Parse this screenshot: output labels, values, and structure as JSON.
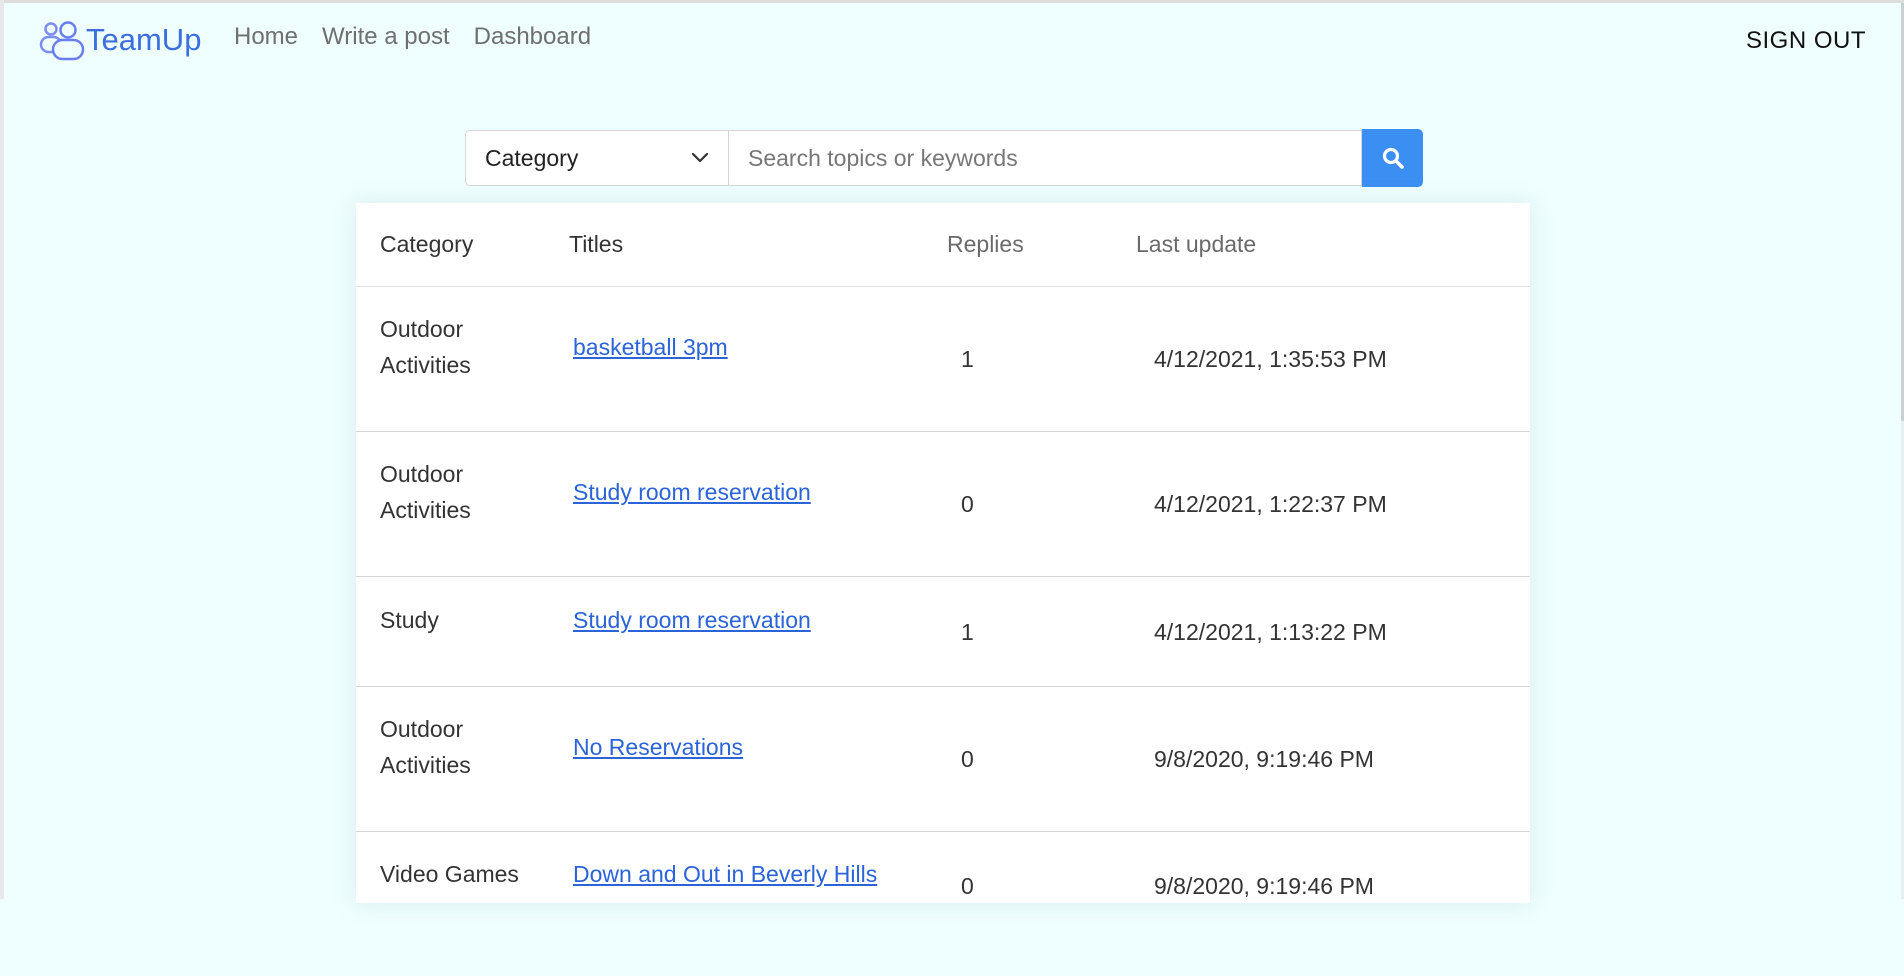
{
  "navbar": {
    "brand": "TeamUp",
    "links": [
      "Home",
      "Write a post",
      "Dashboard"
    ],
    "sign_out": "SIGN OUT"
  },
  "search": {
    "category_label": "Category",
    "placeholder": "Search topics or keywords"
  },
  "table": {
    "headers": {
      "category": "Category",
      "titles": "Titles",
      "replies": "Replies",
      "last_update": "Last update"
    },
    "rows": [
      {
        "category": "Outdoor Activities",
        "title": "basketball 3pm",
        "replies": "1",
        "updated": "4/12/2021, 1:35:53 PM"
      },
      {
        "category": "Outdoor Activities",
        "title": "Study room reservation",
        "replies": "0",
        "updated": "4/12/2021, 1:22:37 PM"
      },
      {
        "category": "Study",
        "title": "Study room reservation",
        "replies": "1",
        "updated": "4/12/2021, 1:13:22 PM"
      },
      {
        "category": "Outdoor Activities",
        "title": "No Reservations",
        "replies": "0",
        "updated": "9/8/2020, 9:19:46 PM"
      },
      {
        "category": "Video Games",
        "title": "Down and Out in Beverly Hills",
        "replies": "0",
        "updated": "9/8/2020, 9:19:46 PM"
      }
    ]
  },
  "colors": {
    "page_background": "#effefe",
    "brand": "#3b6fe0",
    "link": "#2b63d9",
    "search_button": "#3b8ff3"
  },
  "icons": {
    "brand": "team-icon",
    "select": "chevron-down-icon",
    "search": "search-icon"
  }
}
